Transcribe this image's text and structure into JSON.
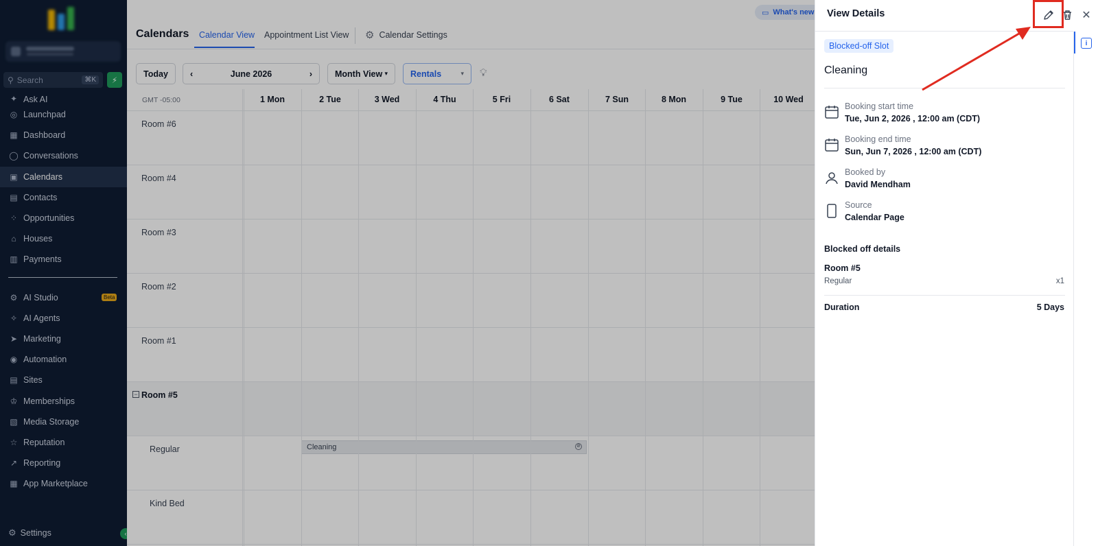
{
  "sidebar": {
    "search_placeholder": "Search",
    "search_shortcut": "⌘K",
    "items": [
      {
        "label": "Ask AI",
        "icon": "sparkle-icon"
      },
      {
        "label": "Launchpad",
        "icon": "rocket-icon"
      },
      {
        "label": "Dashboard",
        "icon": "grid-icon"
      },
      {
        "label": "Conversations",
        "icon": "chat-icon"
      },
      {
        "label": "Calendars",
        "icon": "calendar-icon",
        "active": true
      },
      {
        "label": "Contacts",
        "icon": "contacts-icon"
      },
      {
        "label": "Opportunities",
        "icon": "opportunities-icon"
      },
      {
        "label": "Houses",
        "icon": "house-icon"
      },
      {
        "label": "Payments",
        "icon": "payments-icon"
      }
    ],
    "items2": [
      {
        "label": "AI Studio",
        "icon": "ai-studio-icon",
        "badge": "Beta"
      },
      {
        "label": "AI Agents",
        "icon": "ai-agents-icon"
      },
      {
        "label": "Marketing",
        "icon": "send-icon"
      },
      {
        "label": "Automation",
        "icon": "automation-icon"
      },
      {
        "label": "Sites",
        "icon": "sites-icon"
      },
      {
        "label": "Memberships",
        "icon": "membership-icon"
      },
      {
        "label": "Media Storage",
        "icon": "media-icon"
      },
      {
        "label": "Reputation",
        "icon": "star-icon"
      },
      {
        "label": "Reporting",
        "icon": "chart-icon"
      },
      {
        "label": "App Marketplace",
        "icon": "apps-icon"
      }
    ],
    "settings_label": "Settings"
  },
  "header": {
    "title": "Calendars",
    "tabs": [
      "Calendar View",
      "Appointment List View"
    ],
    "settings_label": "Calendar Settings",
    "whats_new": "What's new"
  },
  "toolbar": {
    "today": "Today",
    "month": "June 2026",
    "view": "Month View",
    "calendar": "Rentals"
  },
  "calendar": {
    "timezone": "GMT -05:00",
    "days": [
      "1 Mon",
      "2 Tue",
      "3 Wed",
      "4 Thu",
      "5 Fri",
      "6 Sat",
      "7 Sun",
      "8 Mon",
      "9 Tue",
      "10 Wed"
    ],
    "rows": [
      "Room #6",
      "Room #4",
      "Room #3",
      "Room #2",
      "Room #1",
      "Room #5",
      "Regular",
      "Kind Bed"
    ],
    "event_label": "Cleaning"
  },
  "panel": {
    "title": "View Details",
    "badge": "Blocked-off Slot",
    "name": "Cleaning",
    "start_label": "Booking start time",
    "start_value": "Tue, Jun 2, 2026 , 12:00 am (CDT)",
    "end_label": "Booking end time",
    "end_value": "Sun, Jun 7, 2026 , 12:00 am (CDT)",
    "booked_label": "Booked by",
    "booked_value": "David Mendham",
    "source_label": "Source",
    "source_value": "Calendar Page",
    "section": "Blocked off details",
    "room": "Room #5",
    "room_type": "Regular",
    "room_qty": "x1",
    "duration_label": "Duration",
    "duration_value": "5 Days"
  },
  "colors": {
    "sidebar_bg": "#0f1d33",
    "accent": "#2563eb",
    "highlight": "#e02b20"
  }
}
